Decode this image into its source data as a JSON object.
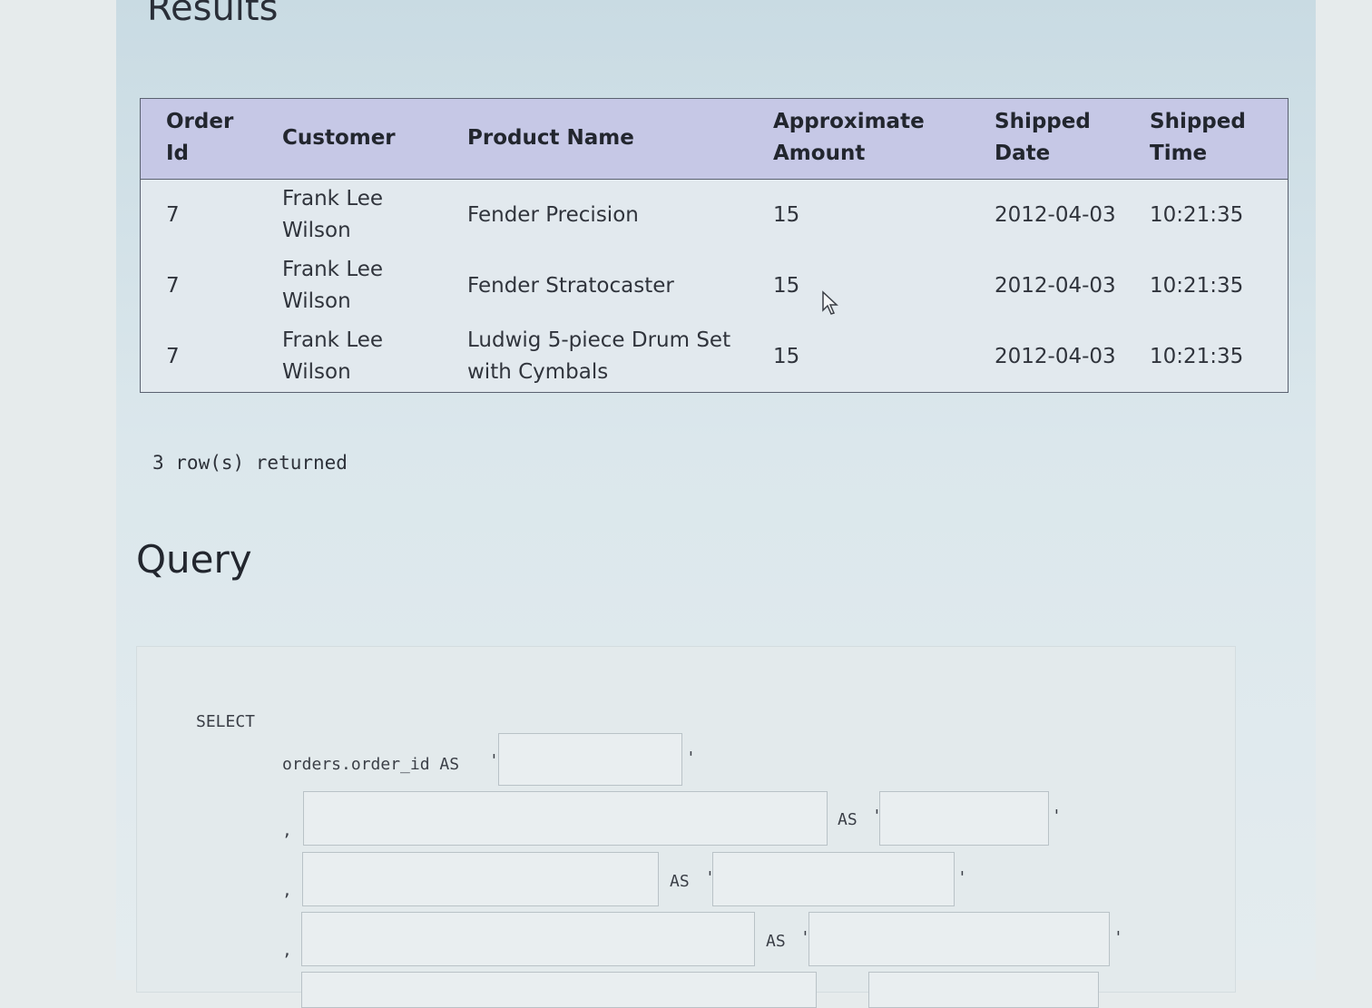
{
  "results": {
    "title": "Results",
    "columns": [
      "Order Id",
      "Customer",
      "Product Name",
      "Approximate Amount",
      "Shipped Date",
      "Shipped Time"
    ],
    "rows": [
      [
        "7",
        "Frank Lee Wilson",
        "Fender Precision",
        "15",
        "2012-04-03",
        "10:21:35"
      ],
      [
        "7",
        "Frank Lee Wilson",
        "Fender Stratocaster",
        "15",
        "2012-04-03",
        "10:21:35"
      ],
      [
        "7",
        "Frank Lee Wilson",
        "Ludwig 5-piece Drum Set with Cymbals",
        "15",
        "2012-04-03",
        "10:21:35"
      ]
    ],
    "row_count": "3 row(s) returned"
  },
  "query": {
    "title": "Query",
    "select_keyword": "SELECT",
    "first_column": "orders.order_id AS",
    "as_keyword": "AS",
    "comma": ",",
    "quote": "'",
    "fields": {
      "alias_1": "",
      "expr_2": "",
      "alias_2": "",
      "expr_3": "",
      "alias_3": "",
      "expr_4": "",
      "alias_4": ""
    }
  },
  "icons": {
    "cursor": "mouse-pointer-icon"
  }
}
